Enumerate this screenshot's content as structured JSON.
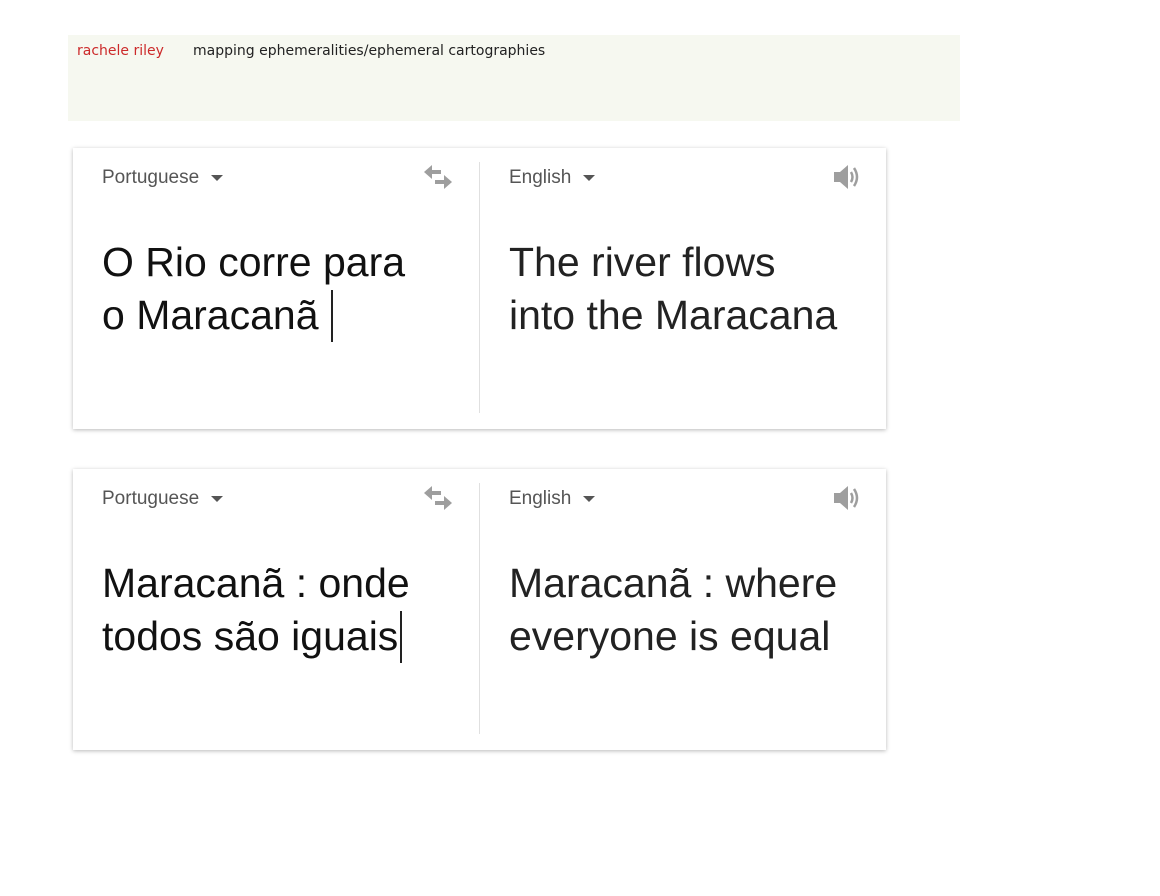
{
  "header": {
    "author": "rachele riley",
    "title": "mapping ephemeralities/ephemeral cartographies"
  },
  "translations": [
    {
      "source_language": "Portuguese",
      "target_language": "English",
      "source_lines": [
        "O Rio corre para",
        "o Maracanã"
      ],
      "target_lines": [
        "The river flows",
        "into the Maracana"
      ]
    },
    {
      "source_language": "Portuguese",
      "target_language": "English",
      "source_lines": [
        "Maracanã : onde",
        "todos são iguais"
      ],
      "target_lines": [
        "Maracanã : where",
        "everyone is equal"
      ]
    }
  ],
  "icons": {
    "language_dropdown": "chevron-down-icon",
    "swap": "swap-languages-icon",
    "listen": "speaker-icon"
  },
  "colors": {
    "header_background": "#f6f8f0",
    "author_link": "#cc2a2a",
    "title_text": "#222222",
    "language_label": "#555555",
    "icon_gray": "#9e9e9e"
  }
}
